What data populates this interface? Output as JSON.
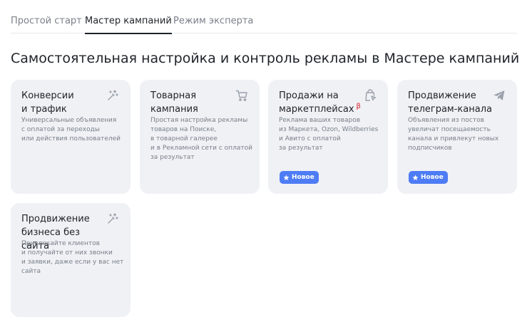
{
  "tabs": [
    {
      "label": "Простой старт"
    },
    {
      "label": "Мастер кампаний"
    },
    {
      "label": "Режим эксперта"
    }
  ],
  "active_tab": "Мастер кампаний",
  "page_title": "Самостоятельная настройка и контроль рекламы в Мастере кампаний",
  "cards": [
    {
      "title_line1": "Конверсии",
      "title_line2": "и трафик",
      "desc": [
        "Универсальные объявления",
        "с оплатой за переходы",
        "или действия пользователей"
      ],
      "icon": "magic-wand-icon"
    },
    {
      "title_line1": "Товарная",
      "title_line2": "кампания",
      "desc": [
        "Простая настройка рекламы",
        "товаров на Поиске,",
        "в товарной галерее",
        "и в Рекламной сети с оплатой",
        "за результат"
      ],
      "icon": "cart-icon"
    },
    {
      "title_line1": "Продажи на",
      "title_line2": "маркетплейсах",
      "beta": "β",
      "desc": [
        "Реклама ваших товаров",
        "из Маркета, Ozon, Wildberries",
        "и Авито с оплатой",
        "за результат"
      ],
      "icon": "shopping-bag-cursor-icon",
      "badge": "Новое"
    },
    {
      "title_line1": "Продвижение",
      "title_line2": "телеграм-канала",
      "desc": [
        "Объявления из постов",
        "увеличат посещаемость",
        "канала и привлекут новых",
        "подписчиков"
      ],
      "icon": "paper-plane-icon",
      "badge": "Новое"
    },
    {
      "title_line1": "Продвижение",
      "title_line2": "бизнеса без сайта",
      "desc": [
        "Привлекайте клиентов",
        "и получайте от них звонки",
        "и заявки, даже если у вас нет",
        "сайта"
      ],
      "icon": "magic-wand-icon"
    }
  ],
  "colors": {
    "card_bg": "#eff1f5",
    "badge_bg": "#4d7cf5",
    "beta": "#e0202e",
    "muted_text": "#7a8089",
    "icon": "#9aa0aa"
  }
}
